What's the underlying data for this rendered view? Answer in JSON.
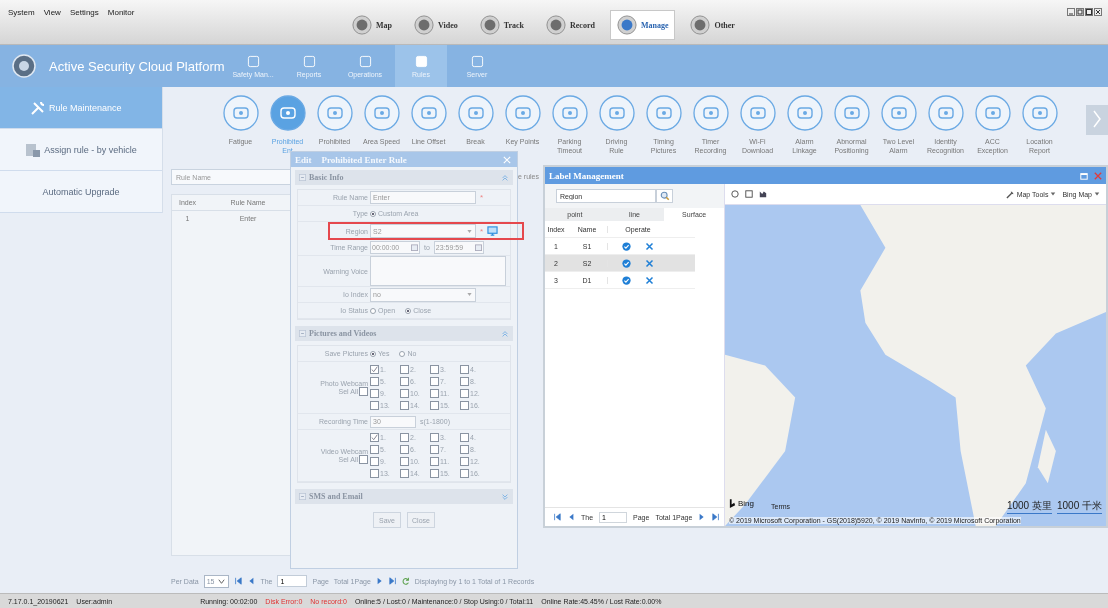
{
  "menu": [
    "System",
    "View",
    "Settings",
    "Monitor"
  ],
  "modules": [
    {
      "label": "Map",
      "selected": false
    },
    {
      "label": "Video",
      "selected": false
    },
    {
      "label": "Track",
      "selected": false
    },
    {
      "label": "Record",
      "selected": false
    },
    {
      "label": "Manage",
      "selected": true
    },
    {
      "label": "Other",
      "selected": false
    }
  ],
  "header": {
    "title": "Active Security Cloud Platform",
    "nav": [
      {
        "label": "Safety Man...",
        "selected": false
      },
      {
        "label": "Reports",
        "selected": false
      },
      {
        "label": "Operations",
        "selected": false
      },
      {
        "label": "Rules",
        "selected": true
      },
      {
        "label": "Server",
        "selected": false
      }
    ]
  },
  "sidebar": [
    {
      "label": "Rule Maintenance",
      "selected": true
    },
    {
      "label": "Assign rule - by vehicle",
      "selected": false
    },
    {
      "label": "Automatic Upgrade",
      "selected": false
    }
  ],
  "rule_types": [
    {
      "lines": [
        "Fatigue"
      ],
      "selected": false
    },
    {
      "lines": [
        "Prohibited",
        "Ent"
      ],
      "selected": true
    },
    {
      "lines": [
        "Prohibited"
      ],
      "selected": false
    },
    {
      "lines": [
        "Area Speed"
      ],
      "selected": false
    },
    {
      "lines": [
        "Line Offset"
      ],
      "selected": false
    },
    {
      "lines": [
        "Break"
      ],
      "selected": false
    },
    {
      "lines": [
        "Key Points"
      ],
      "selected": false
    },
    {
      "lines": [
        "Parking",
        "Timeout"
      ],
      "selected": false
    },
    {
      "lines": [
        "Driving",
        "Rule"
      ],
      "selected": false
    },
    {
      "lines": [
        "Timing",
        "Pictures"
      ],
      "selected": false
    },
    {
      "lines": [
        "Timer",
        "Recording"
      ],
      "selected": false
    },
    {
      "lines": [
        "Wi-Fi",
        "Download"
      ],
      "selected": false
    },
    {
      "lines": [
        "Alarm",
        "Linkage"
      ],
      "selected": false
    },
    {
      "lines": [
        "Abnormal",
        "Positioning"
      ],
      "selected": false
    },
    {
      "lines": [
        "Two Level",
        "Alarm"
      ],
      "selected": false
    },
    {
      "lines": [
        "Identity",
        "Recognition"
      ],
      "selected": false
    },
    {
      "lines": [
        "ACC",
        "Exception"
      ],
      "selected": false
    },
    {
      "lines": [
        "Location",
        "Report"
      ],
      "selected": false
    }
  ],
  "rules_table": {
    "search_placeholder": "Rule Name",
    "side_text": "e rules",
    "columns": [
      "Index",
      "Rule Name"
    ],
    "rows": [
      [
        "1",
        "Enter"
      ]
    ]
  },
  "pager": {
    "per_data_label": "Per Data",
    "per_data": "15",
    "the": "The",
    "page_input": "1",
    "page": "Page",
    "total": "Total 1Page",
    "info": "Displaying by 1 to 1 Total of 1 Records"
  },
  "edit_dialog": {
    "title_prefix": "Edit",
    "title": "Prohibited Enter Rule",
    "required_mark": "*",
    "sections": [
      {
        "title": "Basic Info",
        "expanded": true,
        "fields": [
          {
            "kind": "text",
            "label": "Rule Name",
            "value": "Enter",
            "required": true
          },
          {
            "kind": "radio",
            "label": "Type",
            "options": [
              {
                "label": "Custom Area",
                "selected": true
              }
            ]
          },
          {
            "kind": "select",
            "label": "Region",
            "value": "S2",
            "required": true,
            "highlighted": true,
            "picker": true
          },
          {
            "kind": "timerange",
            "label": "Time Range",
            "from": "00:00:00",
            "sep": "to",
            "to": "23:59:59"
          },
          {
            "kind": "textarea",
            "label": "Warning Voice"
          },
          {
            "kind": "select",
            "label": "Io Index",
            "value": "no",
            "required": false,
            "highlighted": false,
            "picker": false
          },
          {
            "kind": "radio",
            "label": "Io Status",
            "options": [
              {
                "label": "Open",
                "selected": false
              },
              {
                "label": "Close",
                "selected": true
              }
            ]
          }
        ]
      },
      {
        "title": "Pictures and Videos",
        "expanded": true,
        "fields": [
          {
            "kind": "radio",
            "label": "Save Pictures",
            "options": [
              {
                "label": "Yes",
                "selected": true
              },
              {
                "label": "No",
                "selected": false
              }
            ]
          },
          {
            "kind": "checkgrid",
            "label": "Photo Webcam",
            "sel_all": "Sel All",
            "sel_all_checked": false,
            "channels": [
              {
                "label": "1.",
                "checked": true
              },
              {
                "label": "2.",
                "checked": false
              },
              {
                "label": "3.",
                "checked": false
              },
              {
                "label": "4.",
                "checked": false
              },
              {
                "label": "5.",
                "checked": false
              },
              {
                "label": "6.",
                "checked": false
              },
              {
                "label": "7.",
                "checked": false
              },
              {
                "label": "8.",
                "checked": false
              },
              {
                "label": "9.",
                "checked": false
              },
              {
                "label": "10.",
                "checked": false
              },
              {
                "label": "11.",
                "checked": false
              },
              {
                "label": "12.",
                "checked": false
              },
              {
                "label": "13.",
                "checked": false
              },
              {
                "label": "14.",
                "checked": false
              },
              {
                "label": "15.",
                "checked": false
              },
              {
                "label": "16.",
                "checked": false
              }
            ]
          },
          {
            "kind": "number",
            "label": "Recording Time",
            "value": "30",
            "unit": "s(1-1800)"
          },
          {
            "kind": "checkgrid",
            "label": "Video Webcam",
            "sel_all": "Sel All",
            "sel_all_checked": false,
            "channels": [
              {
                "label": "1.",
                "checked": true
              },
              {
                "label": "2.",
                "checked": false
              },
              {
                "label": "3.",
                "checked": false
              },
              {
                "label": "4.",
                "checked": false
              },
              {
                "label": "5.",
                "checked": false
              },
              {
                "label": "6.",
                "checked": false
              },
              {
                "label": "7.",
                "checked": false
              },
              {
                "label": "8.",
                "checked": false
              },
              {
                "label": "9.",
                "checked": false
              },
              {
                "label": "10.",
                "checked": false
              },
              {
                "label": "11.",
                "checked": false
              },
              {
                "label": "12.",
                "checked": false
              },
              {
                "label": "13.",
                "checked": false
              },
              {
                "label": "14.",
                "checked": false
              },
              {
                "label": "15.",
                "checked": false
              },
              {
                "label": "16.",
                "checked": false
              }
            ]
          }
        ]
      },
      {
        "title": "SMS and Email",
        "expanded": false
      }
    ],
    "buttons": [
      "Save",
      "Close"
    ]
  },
  "label_window": {
    "title": "Label Management",
    "search_value": "Region",
    "tabs": [
      {
        "label": "point",
        "selected": false
      },
      {
        "label": "line",
        "selected": false
      },
      {
        "label": "Surface",
        "selected": true
      }
    ],
    "columns": [
      "Index",
      "Name",
      "Operate"
    ],
    "rows": [
      {
        "index": "1",
        "name": "S1",
        "selected": false
      },
      {
        "index": "2",
        "name": "S2",
        "selected": true
      },
      {
        "index": "3",
        "name": "D1",
        "selected": false
      }
    ],
    "pager": {
      "the": "The",
      "page_input": "1",
      "page": "Page",
      "total": "Total 1Page"
    },
    "map": {
      "tools": "Map Tools",
      "provider": "Bing Map",
      "logo": "Bing",
      "copyright": "© 2019 Microsoft Corporation - GS(2018)5920, © 2019 NavInfo, © 2019 Microsoft Corporation",
      "terms": "Terms",
      "scales": [
        "1000 英里",
        "1000 千米"
      ]
    }
  },
  "status_bar": [
    {
      "text": "7.17.0.1_20190621",
      "alert": false
    },
    {
      "text": "User:admin",
      "alert": false
    },
    {
      "text": "Running: 00:02:00",
      "alert": false
    },
    {
      "text": "Disk Error:0",
      "alert": true
    },
    {
      "text": "No record:0",
      "alert": true
    },
    {
      "text": "Online:5 / Lost:0 / Maintenance:0 / Stop Using:0 / Total:11",
      "alert": false
    },
    {
      "text": "Online Rate:45.45% / Lost Rate:0.00%",
      "alert": false
    }
  ]
}
